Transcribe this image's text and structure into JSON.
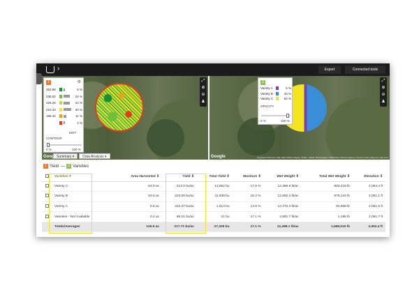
{
  "toolbar": {
    "export_label": "Export",
    "connected_tools_label": "Connected tools"
  },
  "map1": {
    "badge": "1",
    "legend": [
      {
        "value": "252.98",
        "pct": "6 %",
        "color": "#1a8f3a",
        "fill": 0.14
      },
      {
        "value": "238.62",
        "pct": "24 %",
        "color": "#6fbf3c",
        "fill": 0.55
      },
      {
        "value": "226.25",
        "pct": "24 %",
        "color": "#c8d630",
        "fill": 0.55
      },
      {
        "value": "210.23",
        "pct": "30 %",
        "color": "#f3e41f",
        "fill": 0.7
      },
      {
        "value": "196.42",
        "pct": "11 %",
        "color": "#f39a1f",
        "fill": 0.26
      },
      {
        "value": "",
        "pct": "4 %",
        "color": "#e33b1f",
        "fill": 0.1
      }
    ],
    "edit_label": "EDIT",
    "contour_label": "CONTOUR",
    "slider_min": "0 %",
    "slider_max": "100 %"
  },
  "map2": {
    "badge": "2",
    "varieties": [
      {
        "name": "Variety A",
        "color": "#7a3fb3",
        "pct": "5 %"
      },
      {
        "name": "Variety B",
        "color": "#3a8ed8",
        "pct": "43 %"
      },
      {
        "name": "Variety C",
        "color": "#f3e41f",
        "pct": "52 %"
      }
    ],
    "opacity_label": "OPACITY",
    "slider_min": "0 %",
    "slider_max": "100 %"
  },
  "map_common": {
    "google": "Google",
    "credits": "Keyboard shortcuts | Map data ©2021 Imagery ©2021 , Maxar Technologies, USDA Farm Service Agency | Terms of Use | Report a map error"
  },
  "tabs": [
    {
      "label": "Summary ▾"
    },
    {
      "label": "Data Analysis ▾"
    }
  ],
  "panel_title": {
    "yield": "Yield",
    "sep": "—",
    "varieties": "Varieties"
  },
  "table": {
    "headers": [
      "Varieties ▾",
      "Area Harvested ⇕",
      "Yield ⇕",
      "Total Yield ⇕",
      "Moisture ⇕",
      "Wet Weight ⇕",
      "Total Wet Weight ⇕",
      "Elevation ⇕"
    ],
    "rows": [
      [
        "Variety C",
        "64.9 ac",
        "213.0 bu/ac",
        "13,852 bu",
        "17.9 %",
        "12,368.9 lb/ac",
        "803,218 lb",
        "2,064.4 ft"
      ],
      [
        "Variety B",
        "53.5 ac",
        "223.06 bu/ac",
        "11,938 bu",
        "16.3 %",
        "12,692.4 lb/ac",
        "679,144 lb",
        "2,061.1 ft"
      ],
      [
        "Variety A",
        "6.8 ac",
        "222.37 bu/ac",
        "1,514 bu",
        "14.8 %",
        "12,475.4 lb/ac",
        "84,958 lb",
        "2,061.5 ft"
      ],
      [
        "Varieties - Not Available",
        "0.2 ac",
        "85.21 bu/ac",
        "21 bu",
        "17.1 %",
        "4,891.7 lb/ac",
        "1,195 lb",
        "2,061.7 ft"
      ]
    ],
    "totals": [
      "Totals/Averages",
      "125.5 ac",
      "217.71 bu/ac",
      "27,325 bu",
      "17.1 %",
      "12,498.1 lb/ac",
      "1,568,515 lb",
      "2,062.4 ft"
    ]
  }
}
